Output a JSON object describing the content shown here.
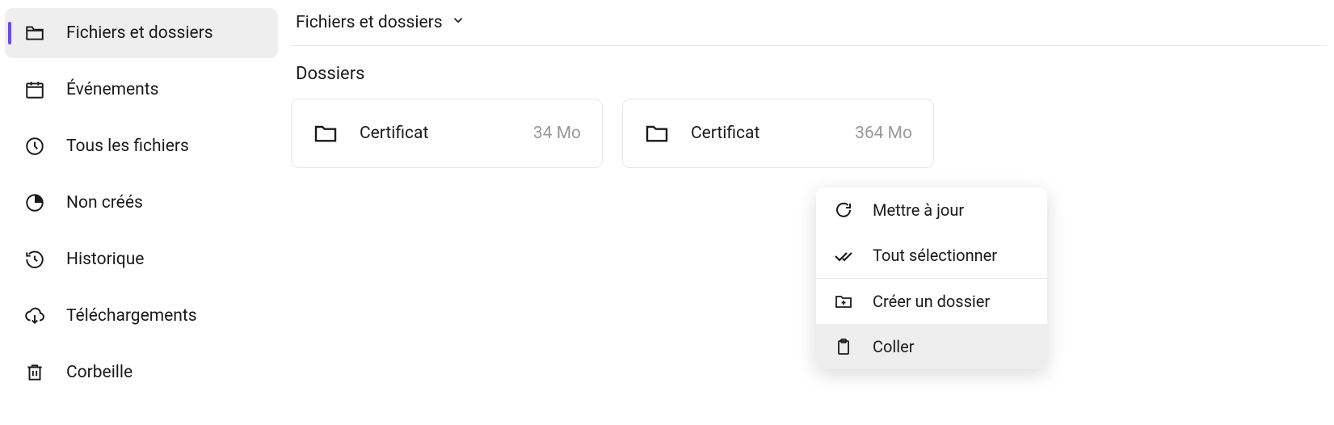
{
  "sidebar": {
    "items": [
      {
        "label": "Fichiers et dossiers",
        "icon": "folder-open-icon",
        "active": true
      },
      {
        "label": "Événements",
        "icon": "calendar-icon",
        "active": false
      },
      {
        "label": "Tous les fichiers",
        "icon": "clock-icon",
        "active": false
      },
      {
        "label": "Non créés",
        "icon": "progress-icon",
        "active": false
      },
      {
        "label": "Historique",
        "icon": "history-icon",
        "active": false
      },
      {
        "label": "Téléchargements",
        "icon": "download-cloud-icon",
        "active": false
      },
      {
        "label": "Corbeille",
        "icon": "trash-icon",
        "active": false
      }
    ]
  },
  "breadcrumb": {
    "label": "Fichiers et dossiers"
  },
  "section": {
    "title": "Dossiers"
  },
  "folders": [
    {
      "name": "Certificat",
      "size": "34 Mo"
    },
    {
      "name": "Certificat",
      "size": "364 Mo"
    }
  ],
  "context_menu": {
    "items": [
      {
        "label": "Mettre à jour",
        "icon": "refresh-icon"
      },
      {
        "label": "Tout sélectionner",
        "icon": "double-check-icon"
      },
      {
        "label": "Créer un dossier",
        "icon": "add-folder-icon"
      },
      {
        "label": "Coller",
        "icon": "clipboard-icon",
        "hover": true
      }
    ]
  }
}
